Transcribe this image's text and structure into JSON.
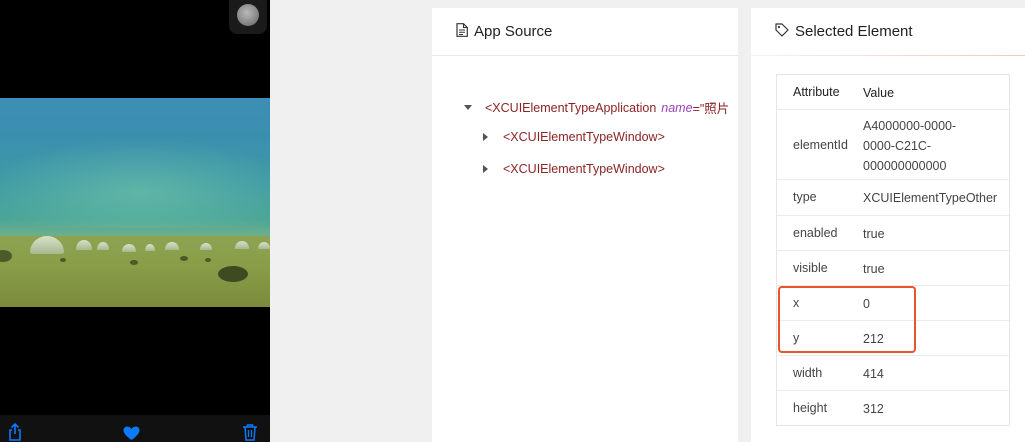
{
  "device": {
    "toolbar_icons": [
      "share-icon",
      "heart-icon",
      "trash-icon"
    ],
    "accent_color": "#0a7aff"
  },
  "app_source": {
    "title": "App Source",
    "icon": "file-icon",
    "tree": {
      "root": {
        "tag_open": "<XCUIElementTypeApplication",
        "attr_name": "name",
        "attr_eq": "=\"照片",
        "children": [
          {
            "label": "<XCUIElementTypeWindow>"
          },
          {
            "label": "<XCUIElementTypeWindow>"
          }
        ]
      }
    }
  },
  "selected_element": {
    "title": "Selected Element",
    "icon": "tag-icon",
    "columns": {
      "attribute": "Attribute",
      "value": "Value"
    },
    "rows": [
      {
        "key": "elementId",
        "value": "A4000000-0000-0000-C21C-000000000000"
      },
      {
        "key": "type",
        "value": "XCUIElementTypeOther"
      },
      {
        "key": "enabled",
        "value": "true"
      },
      {
        "key": "visible",
        "value": "true"
      },
      {
        "key": "x",
        "value": "0"
      },
      {
        "key": "y",
        "value": "212"
      },
      {
        "key": "width",
        "value": "414"
      },
      {
        "key": "height",
        "value": "312"
      }
    ],
    "highlight_color": "#e8542c"
  }
}
